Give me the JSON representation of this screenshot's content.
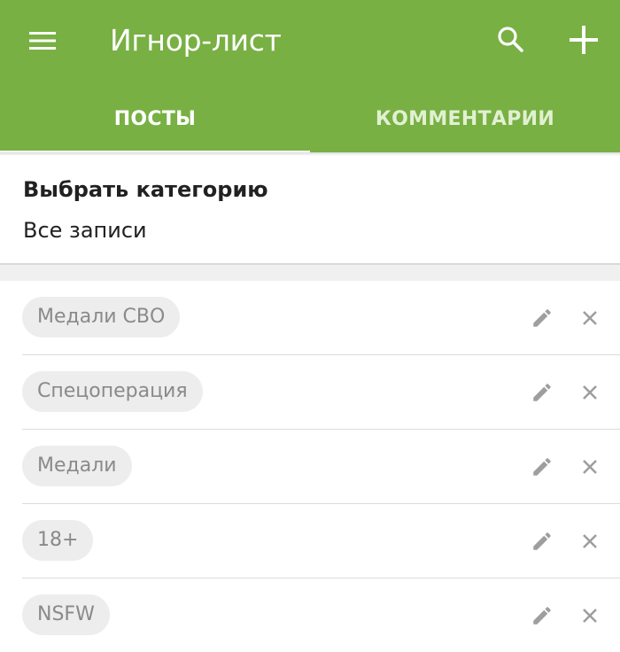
{
  "app_bar": {
    "title": "Игнор-лист",
    "menu_icon": "menu-icon",
    "search_icon": "search-icon",
    "add_icon": "add-icon",
    "color": "#78b043"
  },
  "tabs": [
    {
      "label": "ПОСТЫ",
      "selected": true
    },
    {
      "label": "КОММЕНТАРИИ",
      "selected": false
    }
  ],
  "category": {
    "label": "Выбрать категорию",
    "value": "Все записи"
  },
  "ignore_items": [
    {
      "tag": "Медали СВО"
    },
    {
      "tag": "Спецоперация"
    },
    {
      "tag": "Медали"
    },
    {
      "tag": "18+"
    },
    {
      "tag": "NSFW"
    }
  ],
  "row_icons": {
    "edit": "pencil-icon",
    "delete": "close-icon"
  }
}
